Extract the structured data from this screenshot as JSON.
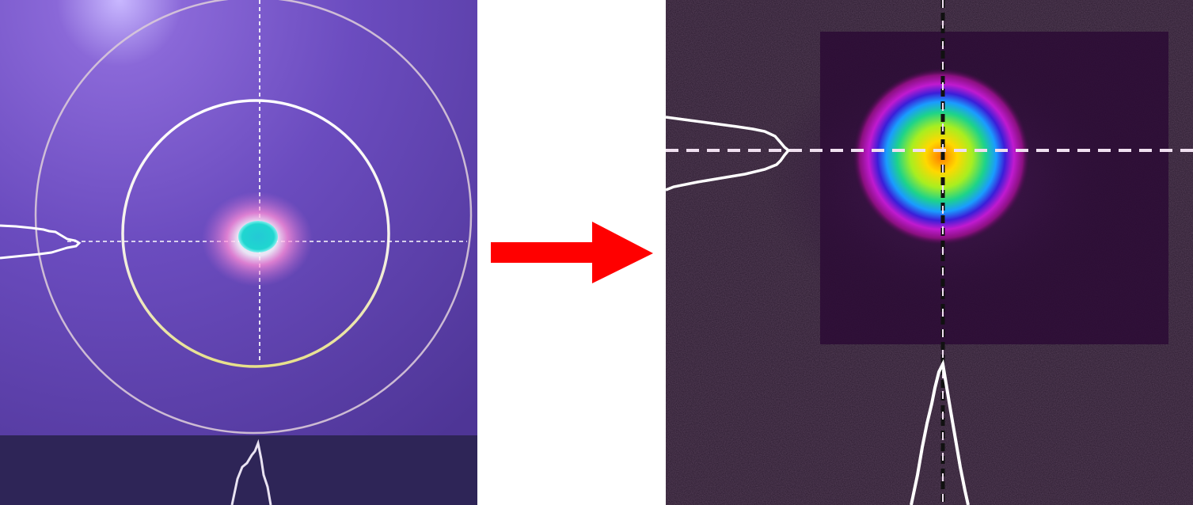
{
  "figure": {
    "left_panel": {
      "description_icon": "beam-profile-before-icon",
      "background_color": "#6a4bb5",
      "beam_core_color": "#1fd6d0",
      "beam_halo_color": "#ff6ec7",
      "outer_ring_color": "#d9c9d8",
      "inner_ring_top_color": "#ffffff",
      "inner_ring_bottom_color": "#e7e08a",
      "crosshair_color": "#ffffff"
    },
    "arrow": {
      "color": "#ff0000",
      "icon": "right-arrow-icon"
    },
    "right_panel": {
      "description_icon": "beam-profile-after-icon",
      "background_color": "#2a1a2e",
      "crosshair_color": "#f0e0f0"
    }
  }
}
